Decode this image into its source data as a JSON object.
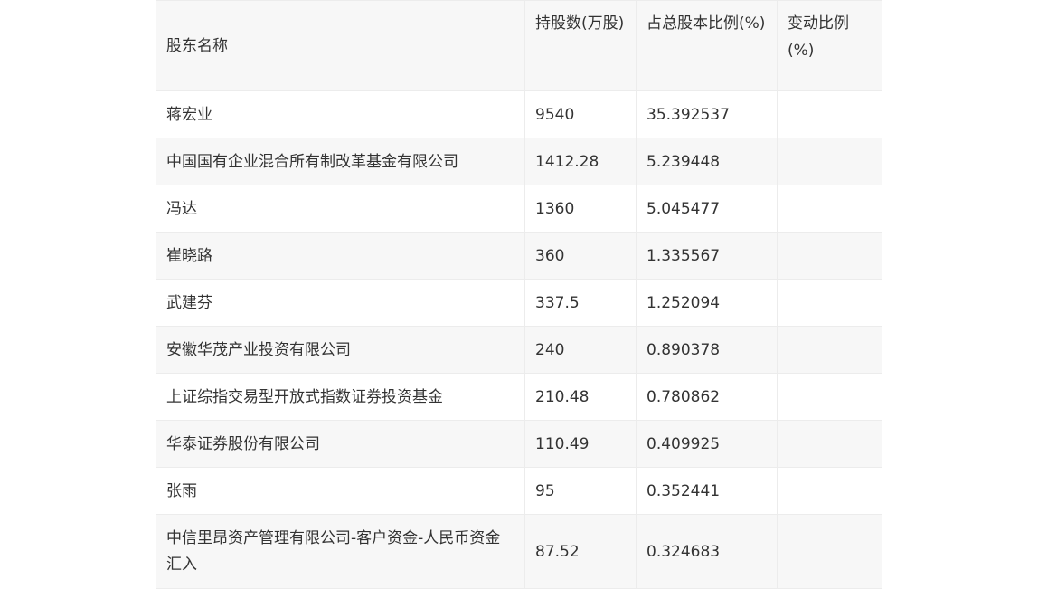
{
  "table": {
    "headers": {
      "name": "股东名称",
      "shares": "持股数(万股)",
      "ratio": "占总股本比例(%)",
      "change": "变动比例(%)"
    },
    "rows": [
      {
        "name": "蒋宏业",
        "shares": "9540",
        "ratio": "35.392537",
        "change": ""
      },
      {
        "name": "中国国有企业混合所有制改革基金有限公司",
        "shares": "1412.28",
        "ratio": "5.239448",
        "change": ""
      },
      {
        "name": "冯达",
        "shares": "1360",
        "ratio": "5.045477",
        "change": ""
      },
      {
        "name": "崔晓路",
        "shares": "360",
        "ratio": "1.335567",
        "change": ""
      },
      {
        "name": "武建芬",
        "shares": "337.5",
        "ratio": "1.252094",
        "change": ""
      },
      {
        "name": "安徽华茂产业投资有限公司",
        "shares": "240",
        "ratio": "0.890378",
        "change": ""
      },
      {
        "name": "上证综指交易型开放式指数证券投资基金",
        "shares": "210.48",
        "ratio": "0.780862",
        "change": ""
      },
      {
        "name": "华泰证券股份有限公司",
        "shares": "110.49",
        "ratio": "0.409925",
        "change": ""
      },
      {
        "name": "张雨",
        "shares": "95",
        "ratio": "0.352441",
        "change": ""
      },
      {
        "name": "中信里昂资产管理有限公司-客户资金-人民币资金汇入",
        "shares": "87.52",
        "ratio": "0.324683",
        "change": ""
      }
    ]
  }
}
